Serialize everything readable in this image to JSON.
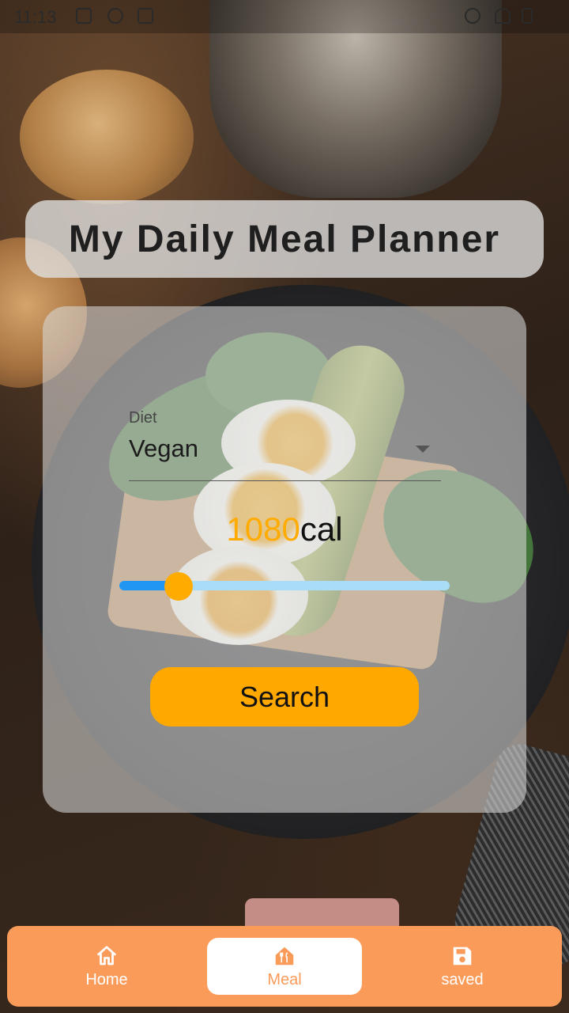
{
  "status_bar": {
    "time": "11:13"
  },
  "title": "My Daily Meal Planner",
  "form": {
    "diet_label": "Diet",
    "diet_value": "Vegan",
    "calories_value": "1080",
    "calories_unit": "cal",
    "slider_fraction": 0.18,
    "search_label": "Search"
  },
  "nav": {
    "items": [
      {
        "label": "Home",
        "icon": "home-icon"
      },
      {
        "label": "Meal",
        "icon": "restaurant-icon",
        "active": true
      },
      {
        "label": "saved",
        "icon": "save-icon"
      }
    ]
  },
  "colors": {
    "accent": "#ffa800",
    "nav_bg": "#fb9b5a",
    "slider_active": "#2196f3",
    "slider_inactive": "#a8dcf7"
  }
}
